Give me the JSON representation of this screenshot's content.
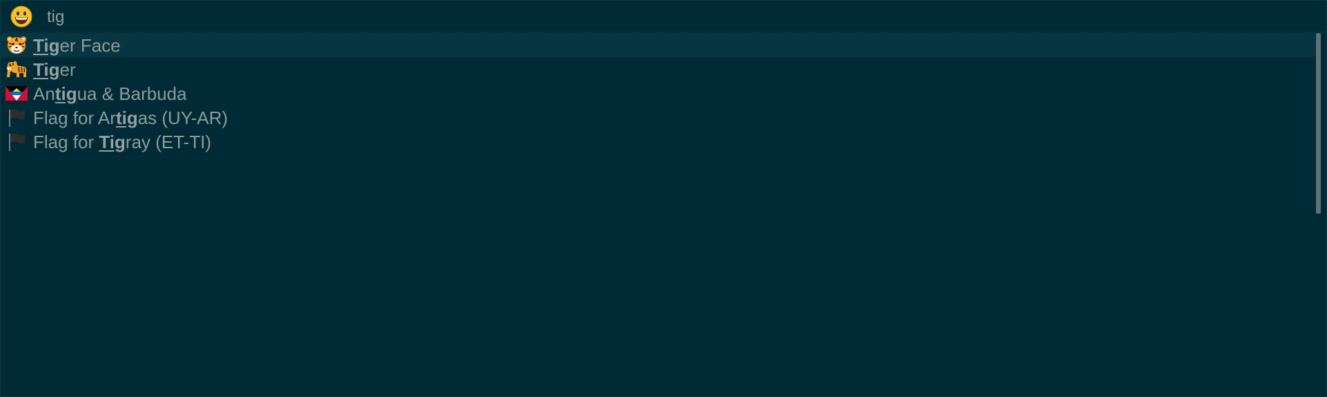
{
  "search": {
    "prompt_icon": "grinning-face-emoji",
    "query": "tig"
  },
  "results": [
    {
      "icon": "tiger-face-emoji",
      "pre": "",
      "match": "Tig",
      "post": "er Face",
      "selected": true
    },
    {
      "icon": "tiger-emoji",
      "pre": "",
      "match": "Tig",
      "post": "er",
      "selected": false
    },
    {
      "icon": "antigua-barbuda-flag-emoji",
      "pre": "An",
      "match": "tig",
      "post": "ua & Barbuda",
      "selected": false
    },
    {
      "icon": "black-flag-emoji",
      "pre": "Flag for Ar",
      "match": "tig",
      "post": "as (UY-AR)",
      "selected": false
    },
    {
      "icon": "black-flag-emoji",
      "pre": "Flag for ",
      "match": "Tig",
      "post": "ray (ET-TI)",
      "selected": false
    }
  ],
  "colors": {
    "background": "#002b36",
    "selected_row": "#073642",
    "text": "#93a1a1",
    "scrollbar": "#5d7276"
  }
}
